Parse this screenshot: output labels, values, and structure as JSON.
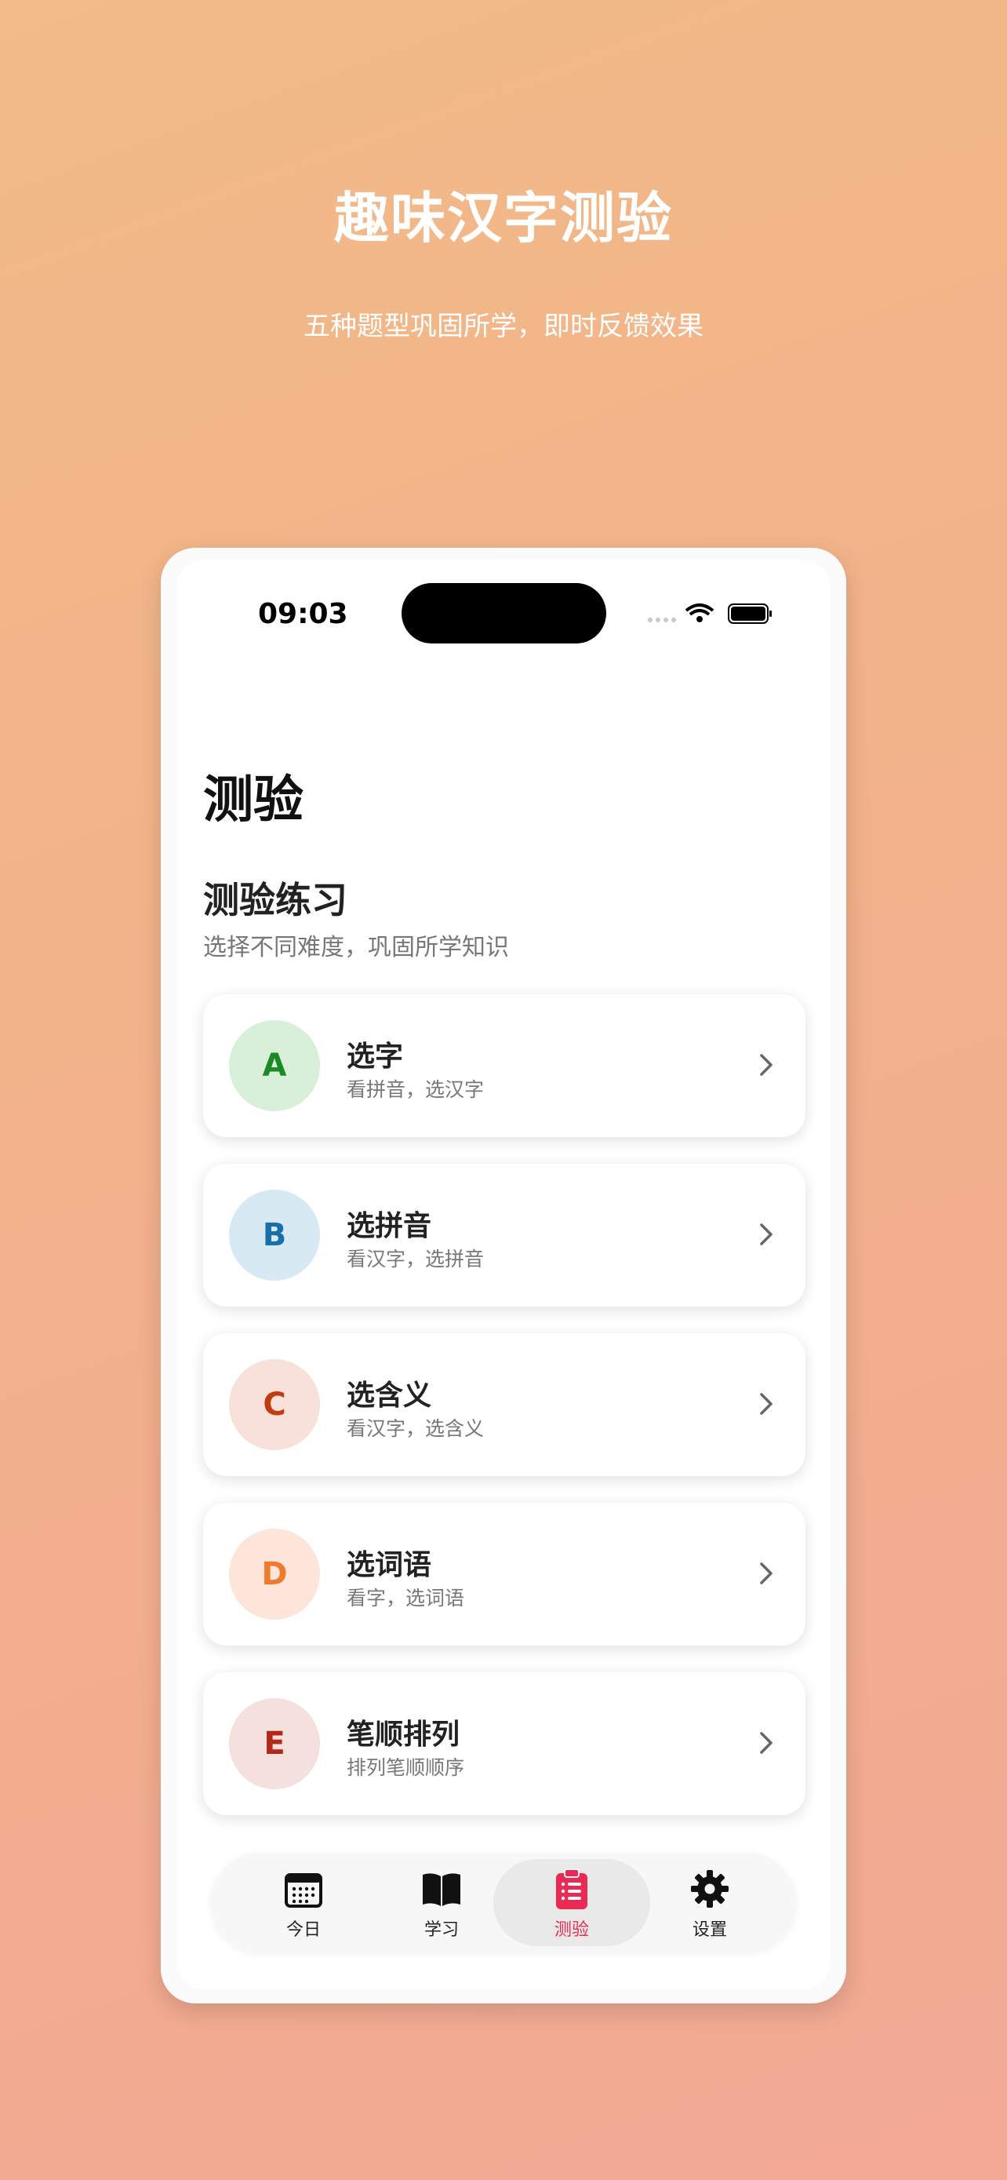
{
  "hero": {
    "title": "趣味汉字测验",
    "subtitle": "五种题型巩固所学，即时反馈效果"
  },
  "status_bar": {
    "time": "09:03"
  },
  "page": {
    "title": "测验",
    "section_title": "测验练习",
    "section_subtitle": "选择不同难度，巩固所学知识"
  },
  "quiz_items": [
    {
      "letter": "A",
      "title": "选字",
      "desc": "看拼音，选汉字",
      "badge_bg": "#d8efd9",
      "badge_fg": "#1a8a24"
    },
    {
      "letter": "B",
      "title": "选拼音",
      "desc": "看汉字，选拼音",
      "badge_bg": "#d7eaf3",
      "badge_fg": "#1a6fa8"
    },
    {
      "letter": "C",
      "title": "选含义",
      "desc": "看汉字，选含义",
      "badge_bg": "#f7e1da",
      "badge_fg": "#c23a12"
    },
    {
      "letter": "D",
      "title": "选词语",
      "desc": "看字，选词语",
      "badge_bg": "#fde6d9",
      "badge_fg": "#f07a2a"
    },
    {
      "letter": "E",
      "title": "笔顺排列",
      "desc": "排列笔顺顺序",
      "badge_bg": "#f4e0dc",
      "badge_fg": "#b2281a"
    }
  ],
  "tabbar": {
    "tabs": [
      {
        "label": "今日",
        "icon": "calendar-icon"
      },
      {
        "label": "学习",
        "icon": "book-icon"
      },
      {
        "label": "测验",
        "icon": "clipboard-icon",
        "active": true
      },
      {
        "label": "设置",
        "icon": "gear-icon"
      }
    ]
  },
  "colors": {
    "accent": "#ea2a52"
  }
}
